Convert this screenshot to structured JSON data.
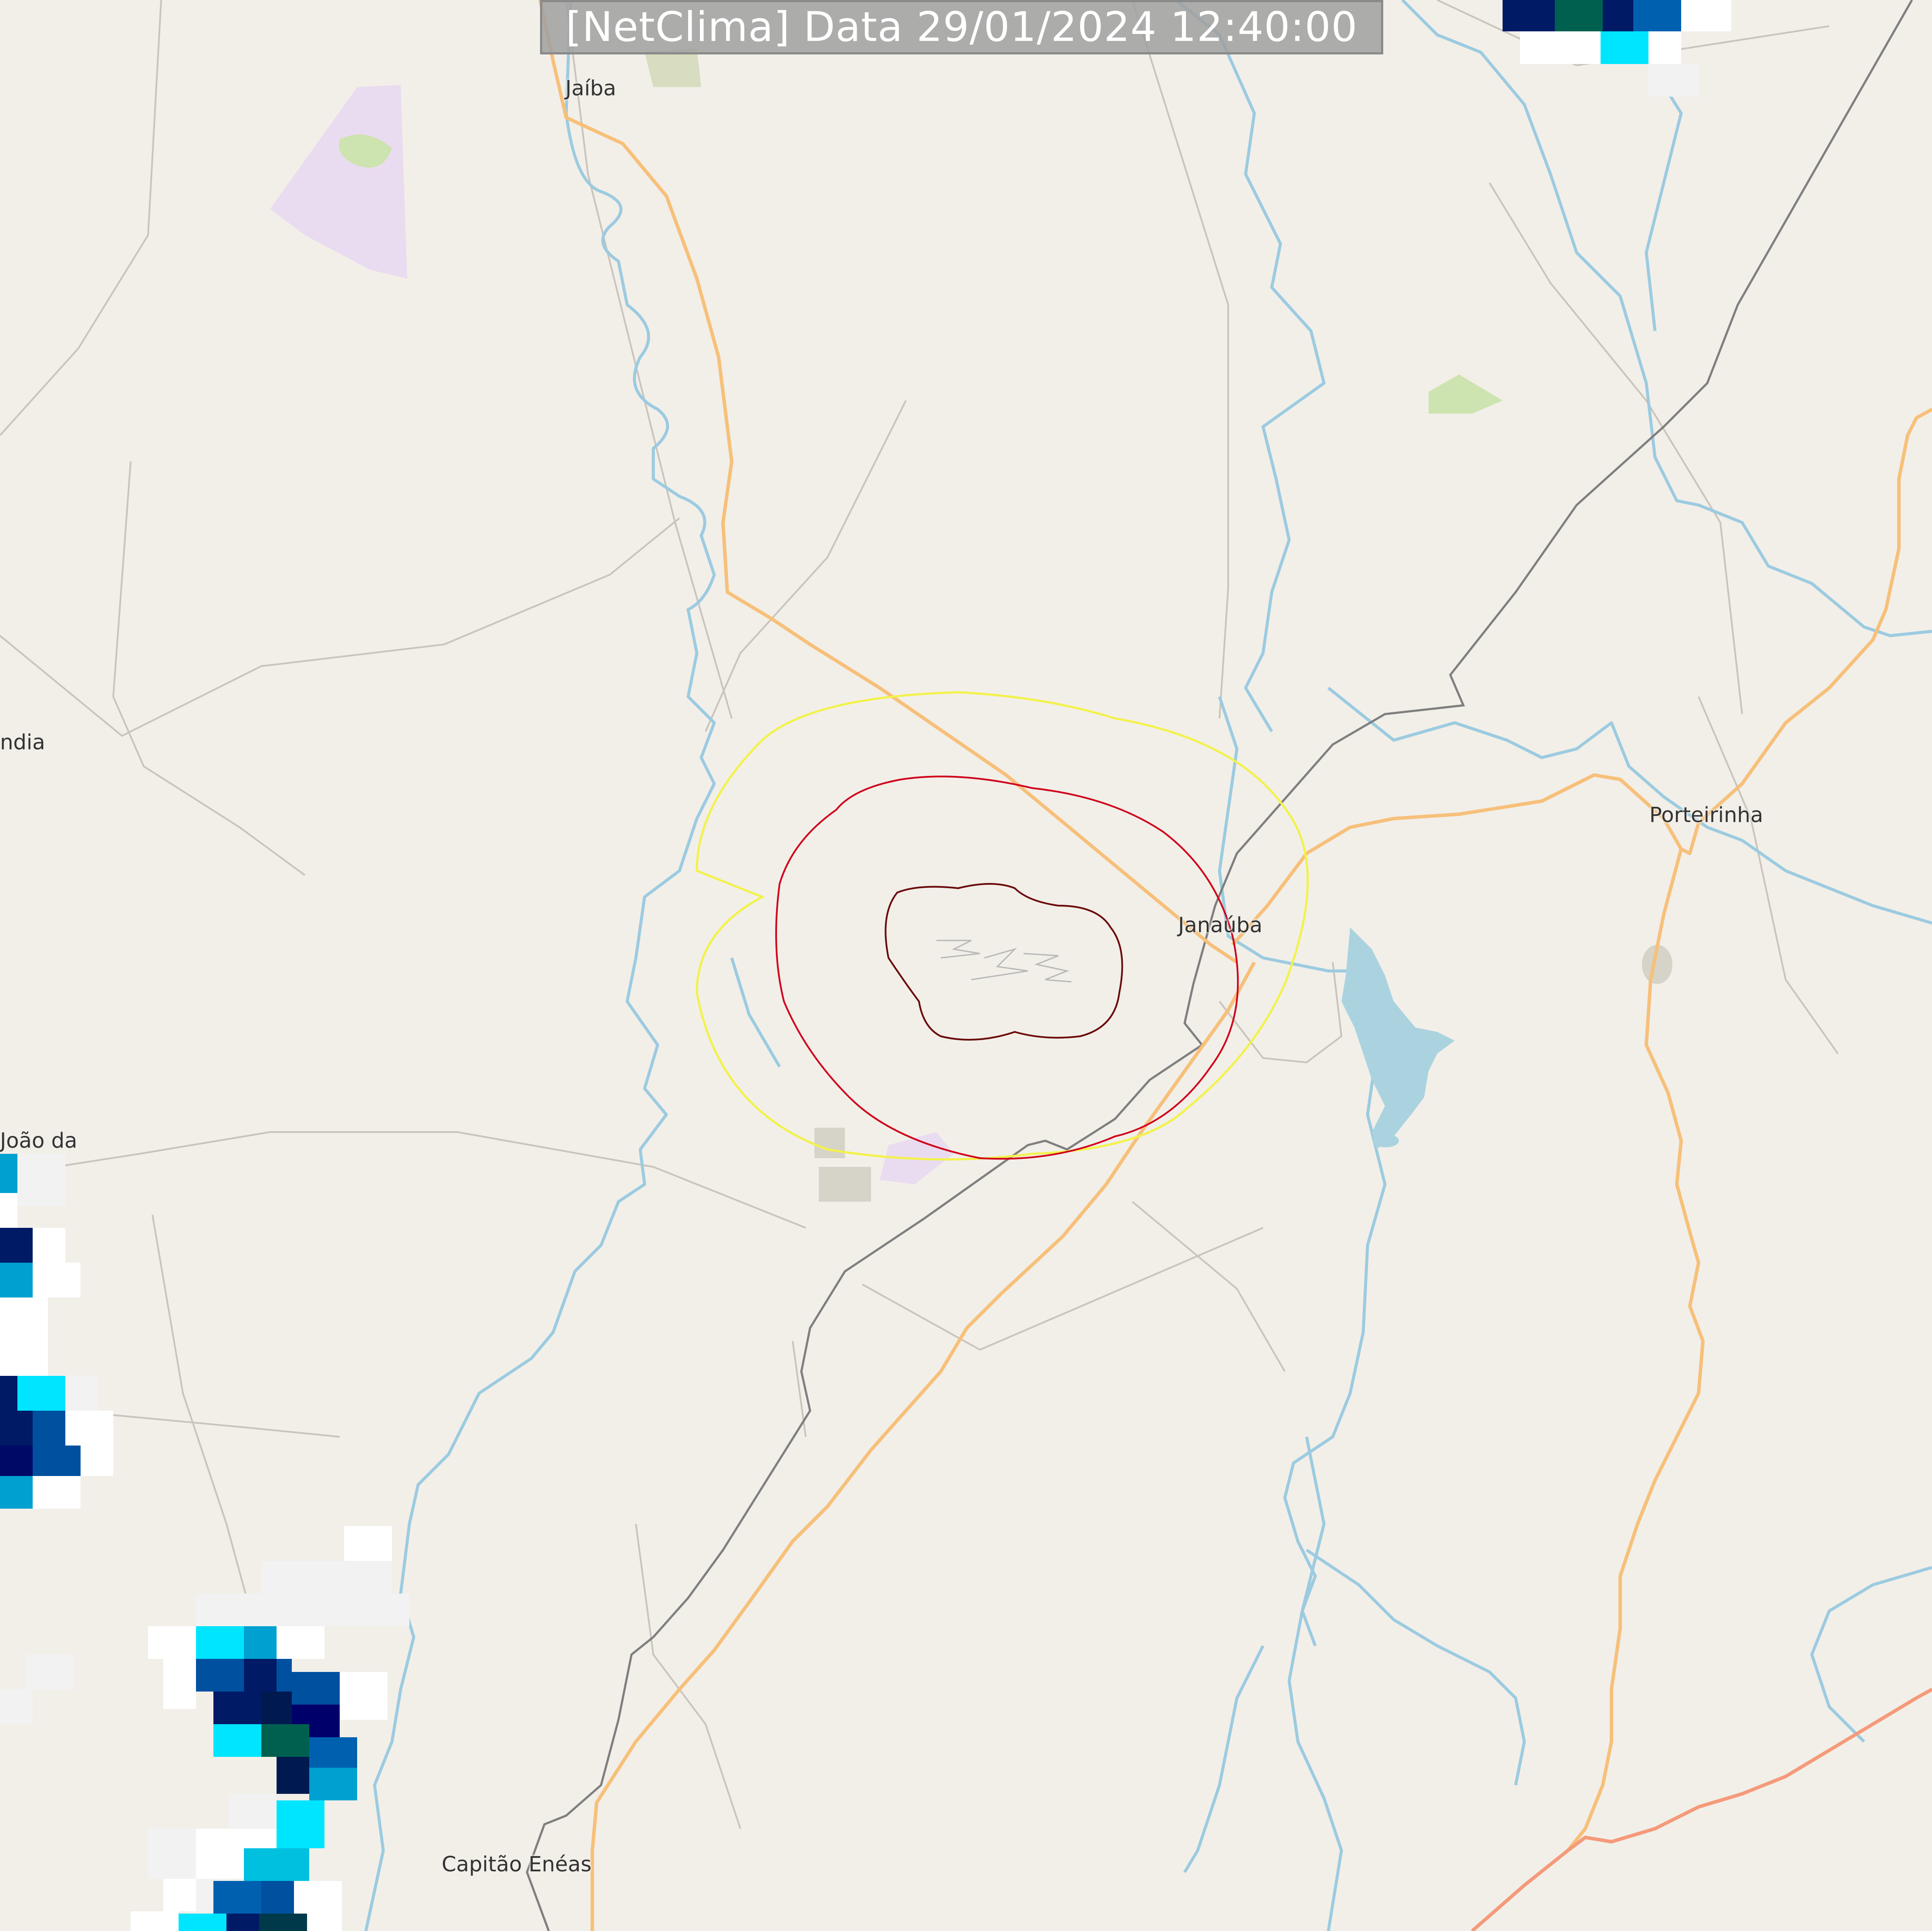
{
  "header": {
    "title": "[NetClima] Data 29/01/2024 12:40:00"
  },
  "places": {
    "jaiba": "Jaíba",
    "janauba": "Janaúba",
    "porteirinha": "Porteirinha",
    "capitao_eneas": "Capitão Enéas",
    "left_edge_1": "ndia",
    "left_edge_2": "João da"
  },
  "colors": {
    "background": "#f2efe9",
    "river": "#9ccbe0",
    "road_primary": "#f7c07a",
    "road_trunk": "#f59a7a",
    "railway": "#7f7f7f",
    "minor_road": "#c9c4bc",
    "ring_outer": "#f2f24a",
    "ring_middle": "#d0021b",
    "ring_inner": "#6b0b0b",
    "radar_light": "#f2f2f2",
    "radar_cyan": "#00e5ff",
    "radar_blue": "#00a0d0",
    "radar_mid": "#0050a0",
    "radar_dark": "#001a66",
    "radar_green": "#006050"
  }
}
